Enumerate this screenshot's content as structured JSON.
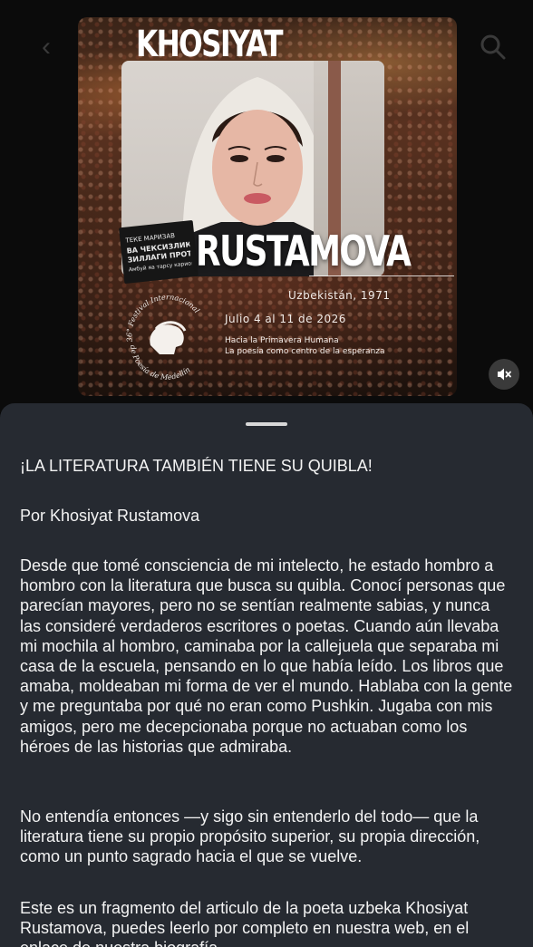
{
  "nav": {
    "back_icon": "chevron-left-icon",
    "back_glyph": "‹",
    "search_icon": "search-icon"
  },
  "post_image": {
    "headline_top": "KHOSIYAT",
    "headline_bottom": "RUSTAMOVA",
    "book_lines": [
      "ТЕКЕ МАРИЗАВ",
      "ВА ЧЕКСИЗЛИК",
      "ЗИЛЛАГИ ПРОТОПИЕМ",
      "Амбуй яа тарсу кариомаб"
    ],
    "country": "Uzbekistán, 1971",
    "dates": "Julio 4 al 11 de 2026",
    "slogan_line1": "Hacia la Primavera Humana",
    "slogan_line2": "La poesía como centro de la esperanza",
    "logo_text_top": "36° Festival Internacional",
    "logo_text_bottom": "de Poesía de Medellín",
    "mute_icon": "speaker-muted-icon",
    "colors": {
      "overlay_text": "#ffffff",
      "mute_bg": "#3a3a3a"
    }
  },
  "sheet": {
    "title": "¡LA LITERATURA TAMBIÉN TIENE SU QUIBLA!",
    "byline": "Por Khosiyat Rustamova",
    "body1": "Desde que tomé consciencia de mi intelecto, he estado hombro a hombro con la literatura que busca su quibla. Conocí personas que parecían mayores, pero no se sentían realmente sabias, y nunca las consideré verdaderos escritores o poetas. Cuando aún llevaba mi mochila al hombro, caminaba por la callejuela que separaba mi casa de la escuela, pensando en lo que había leído. Los libros que amaba, moldeaban mi forma de ver el mundo. Hablaba con la gente y me preguntaba por qué no eran como Pushkin. Jugaba con mis amigos, pero me decepcionaba porque no actuaban como los héroes de las historias que admiraba.",
    "body2": "No entendía entonces —y sigo sin entenderlo del todo— que la literatura tiene su propio propósito superior, su propia dirección, como un punto sagrado hacia el que se vuelve.",
    "body3": "Este es un fragmento del articulo de la poeta uzbeka Khosiyat Rustamova, puedes leerlo por completo en nuestra web, en el enlace de nuestra biografía.",
    "colors": {
      "background": "#262a31",
      "text": "#f3f3f3"
    }
  }
}
